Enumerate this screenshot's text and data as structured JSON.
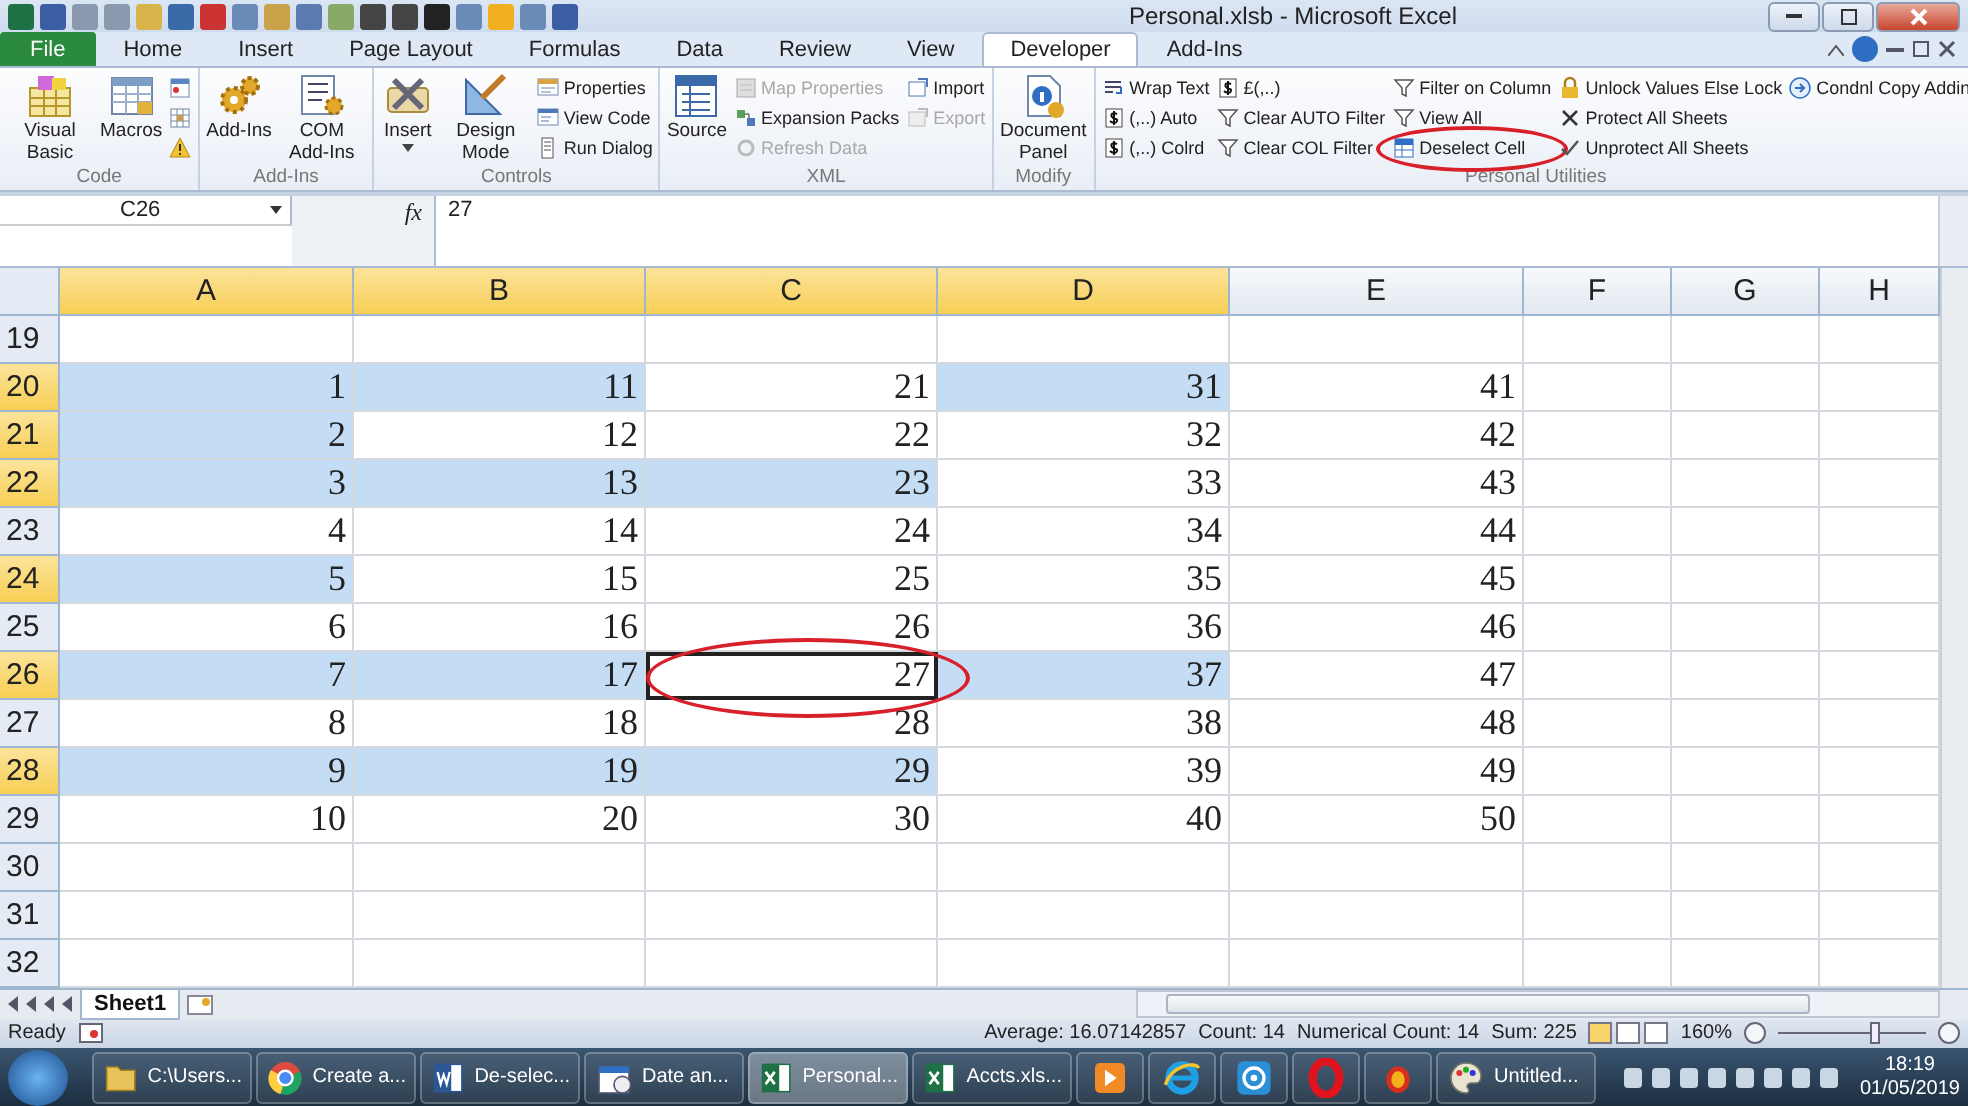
{
  "window": {
    "title": "Personal.xlsb - Microsoft Excel"
  },
  "tabs": [
    {
      "label": "File",
      "kind": "file",
      "selected": false
    },
    {
      "label": "Home",
      "kind": "tab",
      "selected": false
    },
    {
      "label": "Insert",
      "kind": "tab",
      "selected": false
    },
    {
      "label": "Page Layout",
      "kind": "tab",
      "selected": false
    },
    {
      "label": "Formulas",
      "kind": "tab",
      "selected": false
    },
    {
      "label": "Data",
      "kind": "tab",
      "selected": false
    },
    {
      "label": "Review",
      "kind": "tab",
      "selected": false
    },
    {
      "label": "View",
      "kind": "tab",
      "selected": false
    },
    {
      "label": "Developer",
      "kind": "tab",
      "selected": true
    },
    {
      "label": "Add-Ins",
      "kind": "tab",
      "selected": false
    }
  ],
  "ribbon": {
    "groups": [
      {
        "label": "Code",
        "items": [
          {
            "kind": "large",
            "label": "Visual Basic"
          },
          {
            "kind": "large",
            "label": "Macros"
          },
          {
            "kind": "small"
          },
          {
            "kind": "small"
          },
          {
            "kind": "small"
          }
        ]
      },
      {
        "label": "Add-Ins",
        "items": [
          {
            "kind": "large",
            "label": "Add-Ins"
          },
          {
            "kind": "large",
            "label": "COM Add-Ins"
          }
        ]
      },
      {
        "label": "Controls",
        "items": [
          {
            "kind": "large",
            "label": "Insert",
            "dropdown": true
          },
          {
            "kind": "large",
            "label": "Design Mode"
          },
          {
            "kind": "small",
            "label": "Properties"
          },
          {
            "kind": "small",
            "label": "View Code"
          },
          {
            "kind": "small",
            "label": "Run Dialog"
          }
        ]
      },
      {
        "label": "XML",
        "items": [
          {
            "kind": "large",
            "label": "Source",
            "disabled": false
          },
          {
            "kind": "small",
            "label": "Map Properties",
            "disabled": true
          },
          {
            "kind": "small",
            "label": "Expansion Packs",
            "disabled": false
          },
          {
            "kind": "small",
            "label": "Refresh Data",
            "disabled": true
          },
          {
            "kind": "small",
            "label": "Import",
            "disabled": false
          },
          {
            "kind": "small",
            "label": "Export",
            "disabled": true
          }
        ]
      },
      {
        "label": "Modify",
        "items": [
          {
            "kind": "large",
            "label": "Document Panel"
          }
        ]
      },
      {
        "label": "Personal Utilities",
        "items": [
          {
            "kind": "small",
            "label": "Wrap Text"
          },
          {
            "kind": "small",
            "label": "(,..) Auto"
          },
          {
            "kind": "small",
            "label": "(,..) Colrd"
          },
          {
            "kind": "small",
            "label": "£(,..)"
          },
          {
            "kind": "small",
            "label": "Clear AUTO Filter"
          },
          {
            "kind": "small",
            "label": "Clear COL Filter"
          },
          {
            "kind": "small",
            "label": "Filter on Column"
          },
          {
            "kind": "small",
            "label": "View All"
          },
          {
            "kind": "small",
            "label": "Deselect Cell",
            "circled": true
          },
          {
            "kind": "small",
            "label": "Unlock Values Else Lock"
          },
          {
            "kind": "small",
            "label": "Protect All Sheets"
          },
          {
            "kind": "small",
            "label": "Unprotect All Sheets"
          },
          {
            "kind": "small",
            "label": "Condnl Copy Addin"
          }
        ]
      }
    ]
  },
  "formula_bar": {
    "name_box": "C26",
    "function_label": "fx",
    "value": "27"
  },
  "columns": [
    {
      "label": "A",
      "selected": true
    },
    {
      "label": "B",
      "selected": true
    },
    {
      "label": "C",
      "selected": true
    },
    {
      "label": "D",
      "selected": true
    },
    {
      "label": "E",
      "selected": false
    },
    {
      "label": "F",
      "selected": false
    },
    {
      "label": "G",
      "selected": false
    },
    {
      "label": "H",
      "selected": false
    }
  ],
  "rows": [
    {
      "header": "19",
      "selected": false
    },
    {
      "header": "20",
      "selected": true,
      "cells": [
        {
          "value": "1",
          "selected": true
        },
        {
          "value": "11",
          "selected": true
        },
        {
          "value": "21",
          "selected": false
        },
        {
          "value": "31",
          "selected": true
        },
        {
          "value": "41",
          "selected": false
        }
      ]
    },
    {
      "header": "21",
      "selected": true,
      "cells": [
        {
          "value": "2",
          "selected": true
        },
        {
          "value": "12",
          "selected": false
        },
        {
          "value": "22",
          "selected": false
        },
        {
          "value": "32",
          "selected": false
        },
        {
          "value": "42",
          "selected": false
        }
      ]
    },
    {
      "header": "22",
      "selected": true,
      "cells": [
        {
          "value": "3",
          "selected": true
        },
        {
          "value": "13",
          "selected": true
        },
        {
          "value": "23",
          "selected": true
        },
        {
          "value": "33",
          "selected": false
        },
        {
          "value": "43",
          "selected": false
        }
      ]
    },
    {
      "header": "23",
      "selected": false,
      "cells": [
        {
          "value": "4",
          "selected": false
        },
        {
          "value": "14",
          "selected": false
        },
        {
          "value": "24",
          "selected": false
        },
        {
          "value": "34",
          "selected": false
        },
        {
          "value": "44",
          "selected": false
        }
      ]
    },
    {
      "header": "24",
      "selected": true,
      "cells": [
        {
          "value": "5",
          "selected": true
        },
        {
          "value": "15",
          "selected": false
        },
        {
          "value": "25",
          "selected": false
        },
        {
          "value": "35",
          "selected": false
        },
        {
          "value": "45",
          "selected": false
        }
      ]
    },
    {
      "header": "25",
      "selected": false,
      "cells": [
        {
          "value": "6",
          "selected": false
        },
        {
          "value": "16",
          "selected": false
        },
        {
          "value": "26",
          "selected": false
        },
        {
          "value": "36",
          "selected": false
        },
        {
          "value": "46",
          "selected": false
        }
      ]
    },
    {
      "header": "26",
      "selected": true,
      "cells": [
        {
          "value": "7",
          "selected": true
        },
        {
          "value": "17",
          "selected": true
        },
        {
          "value": "27",
          "selected": false,
          "active": true,
          "circled": true
        },
        {
          "value": "37",
          "selected": true
        },
        {
          "value": "47",
          "selected": false
        }
      ]
    },
    {
      "header": "27",
      "selected": false,
      "cells": [
        {
          "value": "8",
          "selected": false
        },
        {
          "value": "18",
          "selected": false
        },
        {
          "value": "28",
          "selected": false
        },
        {
          "value": "38",
          "selected": false
        },
        {
          "value": "48",
          "selected": false
        }
      ]
    },
    {
      "header": "28",
      "selected": true,
      "cells": [
        {
          "value": "9",
          "selected": true
        },
        {
          "value": "19",
          "selected": true
        },
        {
          "value": "29",
          "selected": true
        },
        {
          "value": "39",
          "selected": false
        },
        {
          "value": "49",
          "selected": false
        }
      ]
    },
    {
      "header": "29",
      "selected": false,
      "cells": [
        {
          "value": "10",
          "selected": false
        },
        {
          "value": "20",
          "selected": false
        },
        {
          "value": "30",
          "selected": false
        },
        {
          "value": "40",
          "selected": false
        },
        {
          "value": "50",
          "selected": false
        }
      ]
    },
    {
      "header": "30",
      "selected": false
    },
    {
      "header": "31",
      "selected": false
    },
    {
      "header": "32",
      "selected": false
    }
  ],
  "sheet_tabs": [
    {
      "label": "Sheet1",
      "selected": true
    }
  ],
  "status_bar": {
    "mode": "Ready",
    "stats": [
      "Average: 16.07142857",
      "Count: 14",
      "Numerical Count: 14",
      "Sum: 225"
    ],
    "zoom": {
      "reading": "160%",
      "level": 0.65
    }
  },
  "taskbar": {
    "items": [
      {
        "label": "C:\\Users...",
        "selected": false
      },
      {
        "label": "Create a...",
        "selected": false
      },
      {
        "label": "De-selec...",
        "selected": false
      },
      {
        "label": "Date an...",
        "selected": false
      },
      {
        "label": "Personal...",
        "selected": true
      },
      {
        "label": "Accts.xls...",
        "selected": false
      },
      {
        "selected": false
      },
      {
        "selected": false
      },
      {
        "selected": false
      },
      {
        "selected": false
      },
      {
        "selected": false
      },
      {
        "label": "Untitled...",
        "selected": false
      }
    ],
    "time": "18:19",
    "date": "01/05/2019"
  }
}
